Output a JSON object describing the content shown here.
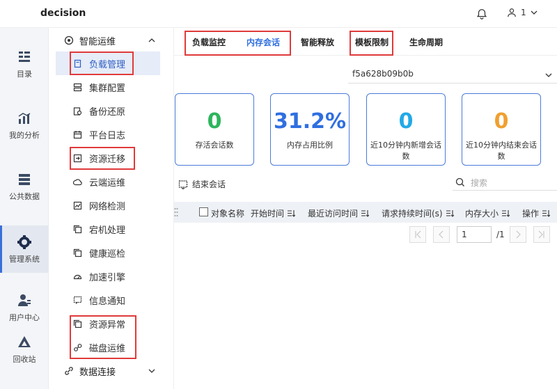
{
  "app": {
    "brand": "decision",
    "user_label": "1"
  },
  "leftnav": [
    {
      "label": "目录",
      "icon": "catalog-icon"
    },
    {
      "label": "我的分析",
      "icon": "analysis-icon"
    },
    {
      "label": "公共数据",
      "icon": "public-data-icon"
    },
    {
      "label": "管理系统",
      "icon": "management-gear-icon"
    },
    {
      "label": "用户中心",
      "icon": "user-center-icon"
    },
    {
      "label": "回收站",
      "icon": "recycle-icon"
    }
  ],
  "menu": {
    "group1": "智能运维",
    "items": [
      "负载管理",
      "集群配置",
      "备份还原",
      "平台日志",
      "资源迁移",
      "云端运维",
      "网络检测",
      "宕机处理",
      "健康巡检",
      "加速引擎",
      "信息通知",
      "资源异常",
      "磁盘运维"
    ],
    "group2": "数据连接"
  },
  "tabs": [
    "负载监控",
    "内存会话",
    "智能释放",
    "模板限制",
    "生命周期"
  ],
  "active_tab": "内存会话",
  "session_select": "f5a628b09b0b",
  "cards": [
    {
      "value": "0",
      "caption": "存活会话数",
      "color": "#2db55d"
    },
    {
      "value": "31.2%",
      "caption": "内存占用比例",
      "color": "#2f6fe0"
    },
    {
      "value": "0",
      "caption": "近10分钟内新增会话数",
      "color": "#22a9e8"
    },
    {
      "value": "0",
      "caption": "近10分钟内结束会话数",
      "color": "#f0a030"
    }
  ],
  "end_session_label": "结束会话",
  "search_placeholder": "搜索",
  "columns": [
    "对象名称",
    "开始时间",
    "最近访问时间",
    "请求持续时间(s)",
    "内存大小",
    "操作"
  ],
  "pagination": {
    "current": "1",
    "total": "/1"
  }
}
